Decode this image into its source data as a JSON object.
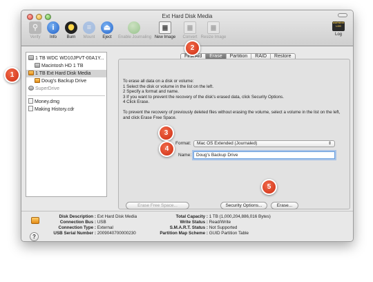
{
  "window": {
    "title": "Ext Hard Disk Media"
  },
  "toolbar": {
    "items": [
      {
        "label": "Verify",
        "icon": "microscope-icon",
        "enabled": false
      },
      {
        "label": "Info",
        "icon": "info-icon",
        "enabled": true
      },
      {
        "label": "Burn",
        "icon": "burn-icon",
        "enabled": true
      },
      {
        "label": "Mount",
        "icon": "mount-icon",
        "enabled": false
      },
      {
        "label": "Eject",
        "icon": "eject-icon",
        "enabled": true
      },
      {
        "label": "Enable Journaling",
        "icon": "journal-icon",
        "enabled": false
      },
      {
        "label": "New Image",
        "icon": "new-image-icon",
        "enabled": true
      },
      {
        "label": "Convert",
        "icon": "convert-icon",
        "enabled": false
      },
      {
        "label": "Resize Image",
        "icon": "resize-image-icon",
        "enabled": false
      }
    ],
    "log_label": "Log",
    "log_badge": "WARNING\nLOG"
  },
  "sidebar": {
    "items": [
      {
        "label": "1 TB WDC WD10JPVT-00A1Y...",
        "level": 0,
        "icon": "disk-icon"
      },
      {
        "label": "Macintosh HD 1 TB",
        "level": 1,
        "icon": "disk-icon"
      },
      {
        "label": "1 TB Ext Hard Disk Media",
        "level": 0,
        "icon": "external-disk-icon",
        "selected": true
      },
      {
        "label": "Doug's Backup Drive",
        "level": 1,
        "icon": "disk-icon"
      },
      {
        "label": "SuperDrive",
        "level": 0,
        "icon": "superdrive-icon",
        "dimmed": true
      },
      {
        "label": "Money.dmg",
        "level": 0,
        "icon": "dmg-icon"
      },
      {
        "label": "Making History.cdr",
        "level": 0,
        "icon": "cdr-icon"
      }
    ]
  },
  "tabs": [
    {
      "label": "First Aid",
      "active": false
    },
    {
      "label": "Erase",
      "active": true
    },
    {
      "label": "Partition",
      "active": false
    },
    {
      "label": "RAID",
      "active": false
    },
    {
      "label": "Restore",
      "active": false
    }
  ],
  "erase": {
    "intro": "To erase all data on a disk or volume:",
    "steps": [
      "1 Select the disk or volume in the list on the left.",
      "2 Specify a format and name.",
      "3 If you want to prevent the recovery of the disk's erased data, click Security Options.",
      "4 Click Erase."
    ],
    "prevent_note": "To prevent the recovery of previously deleted files without erasing the volume, select a volume in the list on the left, and click Erase Free Space.",
    "format_label": "Format:",
    "format_value": "Mac OS Extended (Journaled)",
    "name_label": "Name:",
    "name_value": "Doug's Backup Drive",
    "erase_free_space_label": "Erase Free Space...",
    "security_options_label": "Security Options...",
    "erase_label": "Erase..."
  },
  "info": {
    "disk_description_label": "Disk Description :",
    "disk_description": "Ext Hard Disk Media",
    "connection_bus_label": "Connection Bus :",
    "connection_bus": "USB",
    "connection_type_label": "Connection Type :",
    "connection_type": "External",
    "usb_serial_label": "USB Serial Number :",
    "usb_serial": "2009040700000230",
    "total_capacity_label": "Total Capacity :",
    "total_capacity": "1 TB (1,000,204,886,016 Bytes)",
    "write_status_label": "Write Status :",
    "write_status": "Read/Write",
    "smart_label": "S.M.A.R.T. Status :",
    "smart": "Not Supported",
    "partition_map_label": "Partition Map Scheme :",
    "partition_map": "GUID Partition Table"
  },
  "callouts": [
    "1",
    "2",
    "3",
    "4",
    "5"
  ],
  "colors": {
    "callout": "#d9361a",
    "selection": "#d3d3d3",
    "focus": "#6aa1e0"
  }
}
